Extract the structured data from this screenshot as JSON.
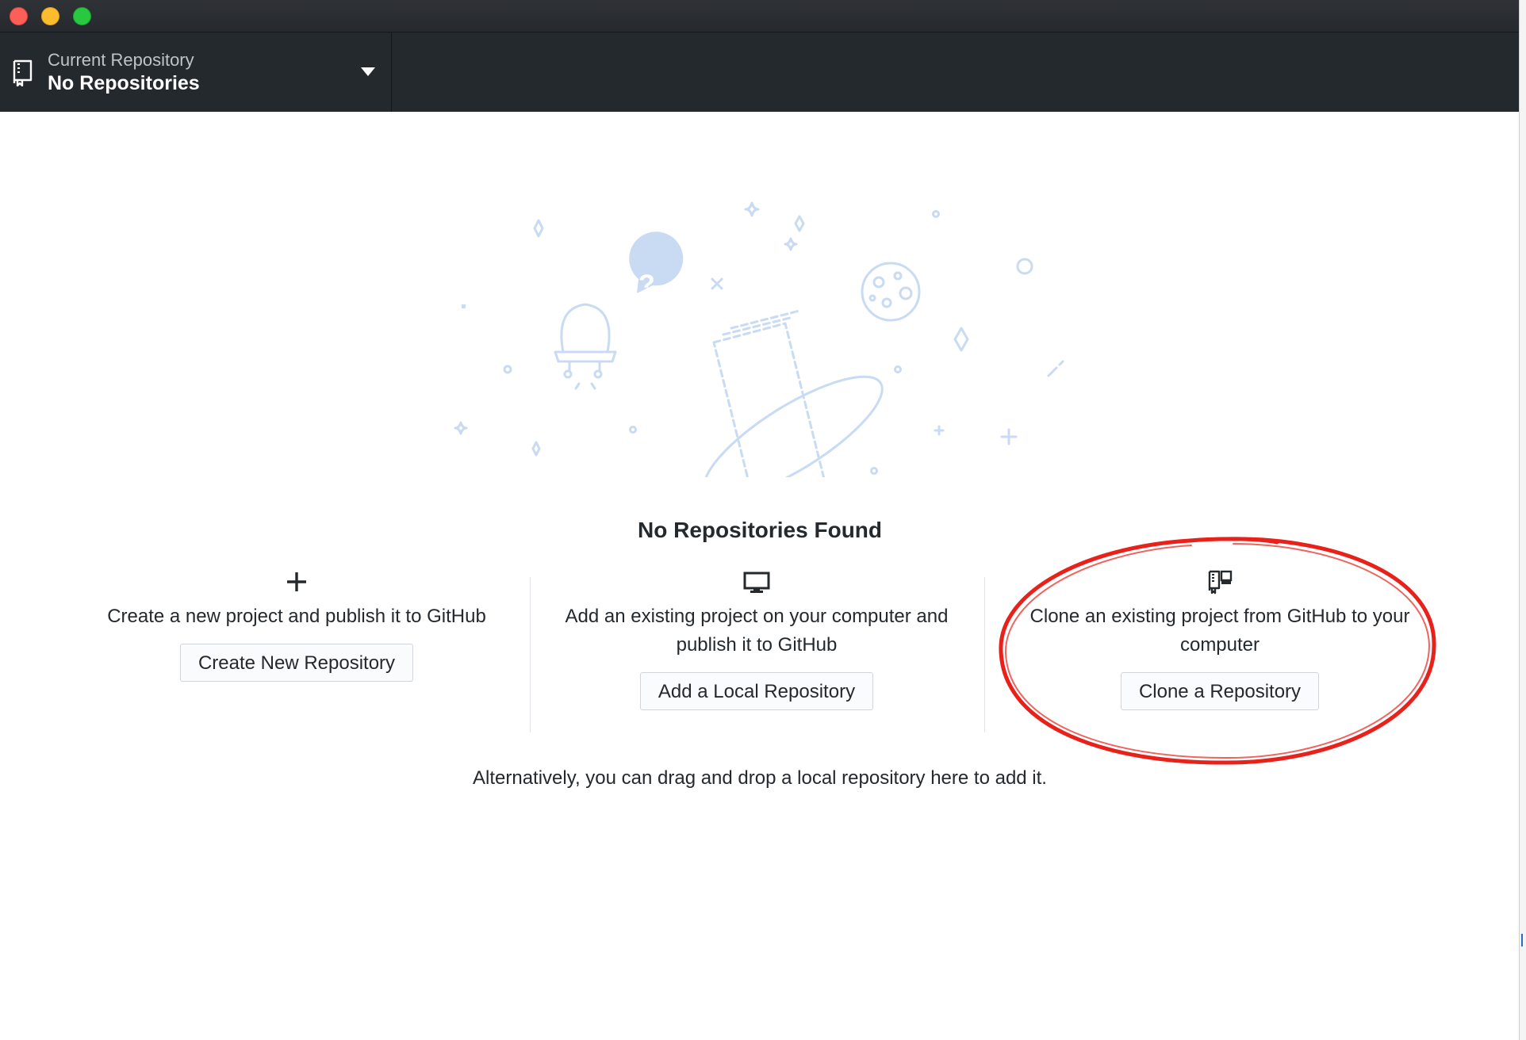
{
  "toolbar": {
    "repo_label": "Current Repository",
    "repo_value": "No Repositories"
  },
  "main": {
    "heading": "No Repositories Found",
    "create": {
      "icon": "plus-icon",
      "description": "Create a new project and publish it to GitHub",
      "button": "Create New Repository"
    },
    "add": {
      "icon": "desktop-icon",
      "description_line1": "Add an existing project on your computer and",
      "description_line2": "publish it to GitHub",
      "button": "Add a Local Repository"
    },
    "clone": {
      "icon": "repo-clone-icon",
      "description_line1": "Clone an existing project from GitHub to your",
      "description_line2": "computer",
      "button": "Clone a Repository"
    },
    "alternative": "Alternatively, you can drag and drop a local repository here to add it."
  },
  "colors": {
    "toolbar_bg": "#24292e",
    "illustration": "#c8dbf2",
    "annotation": "#e8221b"
  }
}
